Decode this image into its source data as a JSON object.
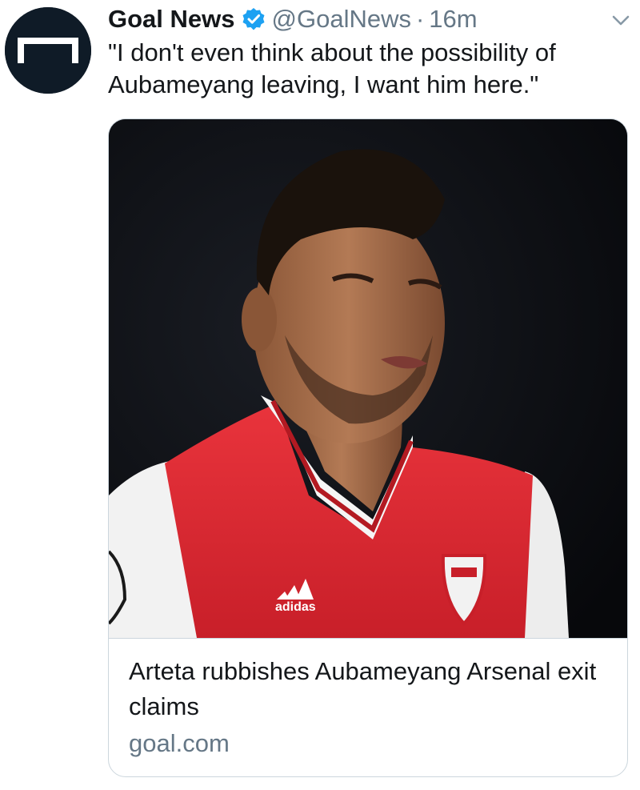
{
  "author": {
    "display_name": "Goal News",
    "handle": "@GoalNews",
    "separator": "·",
    "time": "16m",
    "verified": true,
    "avatar_icon": "goal-frame-icon"
  },
  "tweet": {
    "text": "\"I don't even think about the possibility of Aubameyang leaving, I want him here.\""
  },
  "card": {
    "title": "Arteta rubbishes Aubameyang Arsenal exit claims",
    "domain": "goal.com",
    "image_description_icon": "player-photo"
  },
  "colors": {
    "text_primary": "#14171a",
    "text_secondary": "#657786",
    "verified_blue": "#1da1f2",
    "avatar_bg": "#0f1b27",
    "card_border": "#ccd6dd",
    "shirt_red": "#e0242f"
  },
  "icons": {
    "verified": "verified-badge-icon",
    "menu": "chevron-down-icon"
  }
}
